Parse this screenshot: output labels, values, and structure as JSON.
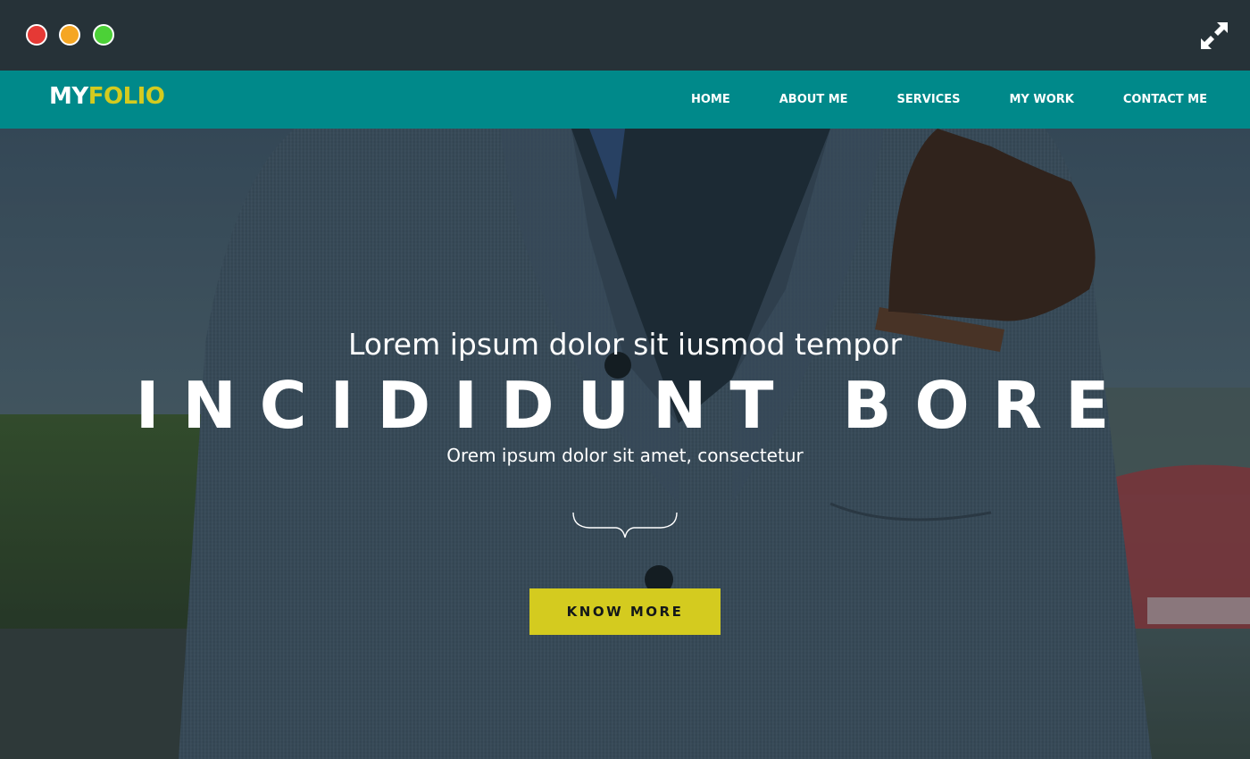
{
  "window": {
    "controls": [
      "close-dot",
      "minimize-dot",
      "zoom-dot"
    ],
    "expand_icon": "expand-arrows-icon"
  },
  "brand": {
    "part1": "MY",
    "part2": "FOLIO",
    "color_primary": "#ffffff",
    "color_accent": "#d4cb1f"
  },
  "nav": {
    "items": [
      {
        "label": "HOME"
      },
      {
        "label": "ABOUT ME"
      },
      {
        "label": "SERVICES"
      },
      {
        "label": "MY WORK"
      },
      {
        "label": "CONTACT ME"
      }
    ],
    "background": "#00898a"
  },
  "hero": {
    "subtitle": "Lorem ipsum dolor sit iusmod tempor",
    "title": "INCIDIDUNT BORE",
    "tagline": "Orem ipsum dolor sit amet, consectetur",
    "divider_icon": "curly-brace-divider-icon",
    "cta_label": "KNOW MORE",
    "cta_color": "#d4cb1f"
  }
}
